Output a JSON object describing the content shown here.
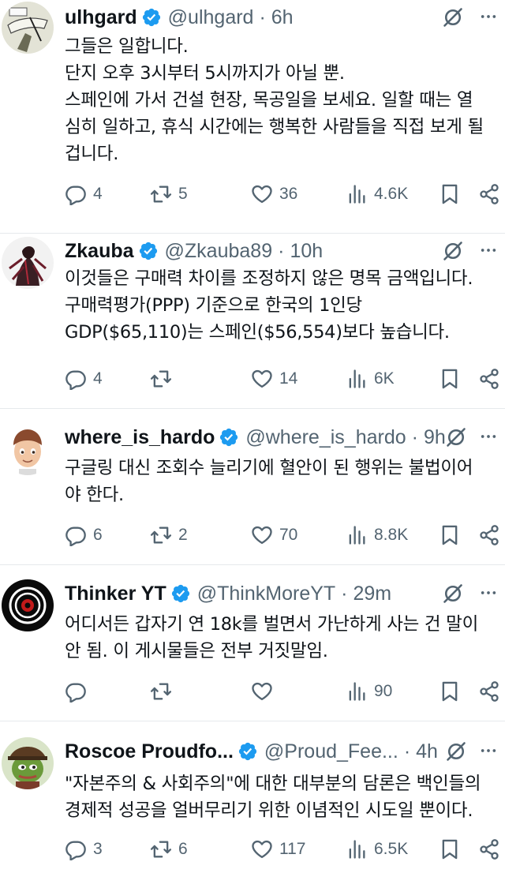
{
  "tweets": [
    {
      "name": "ulhgard",
      "handle": "@ulhgard",
      "time": "6h",
      "lines": [
        "그들은 일합니다.",
        "단지 오후 3시부터 5시까지가 아닐 뿐.",
        "스페인에 가서 건설 현장, 목공일을 보세요. 일할 때는 열",
        "심히 일하고, 휴식 시간에는 행복한 사람들을 직접 보게 될",
        "겁니다."
      ],
      "replies": "4",
      "retweets": "5",
      "likes": "36",
      "views": "4.6K"
    },
    {
      "name": "Zkauba",
      "handle": "@Zkauba89",
      "time": "10h",
      "lines": [
        "이것들은 구매력 차이를 조정하지 않은 명목 금액입니다.",
        "구매력평가(PPP) 기준으로 한국의 1인당",
        "GDP($65,110)는 스페인($56,554)보다 높습니다."
      ],
      "replies": "4",
      "retweets": "",
      "likes": "14",
      "views": "6K"
    },
    {
      "name": "where_is_hardo",
      "handle": "@where_is_hardo",
      "time": "9h",
      "lines": [
        "구글링 대신 조회수 늘리기에 혈안이 된 행위는 불법이어",
        "야 한다."
      ],
      "replies": "6",
      "retweets": "2",
      "likes": "70",
      "views": "8.8K"
    },
    {
      "name": "Thinker YT",
      "handle": "@ThinkMoreYT",
      "time": "29m",
      "lines": [
        "어디서든 갑자기 연 18k를 벌면서 가난하게 사는 건 말이",
        "안 됨. 이 게시물들은 전부 거짓말임."
      ],
      "replies": "",
      "retweets": "",
      "likes": "",
      "views": "90"
    },
    {
      "name": "Roscoe Proudfo...",
      "handle": "@Proud_Fee...",
      "time": "4h",
      "lines": [
        "\"자본주의 & 사회주의\"에 대한 대부분의 담론은 백인들의",
        "경제적 성공을 얼버무리기 위한 이념적인 시도일 뿐이다."
      ],
      "replies": "3",
      "retweets": "6",
      "likes": "117",
      "views": "6.5K"
    }
  ],
  "separator": "·",
  "colors": {
    "verified": "#1d9bf0",
    "text": "#0f1419",
    "secondary": "#536471",
    "divider": "#e6e9ec"
  },
  "icons": [
    "verified-badge-icon",
    "grok-icon",
    "more-icon",
    "reply-icon",
    "retweet-icon",
    "like-icon",
    "views-icon",
    "bookmark-icon",
    "share-icon"
  ]
}
